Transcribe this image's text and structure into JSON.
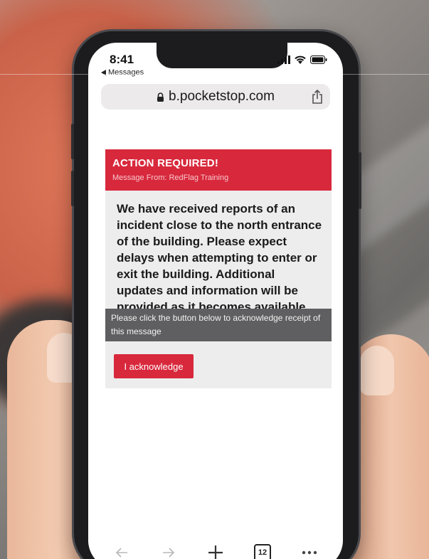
{
  "status_bar": {
    "time": "8:41",
    "back_label": "Messages"
  },
  "browser": {
    "url": "b.pocketstop.com",
    "tab_count": "12"
  },
  "alert": {
    "title": "ACTION REQUIRED!",
    "subtitle": "Message From: RedFlag Training",
    "body": "We have received reports of an incident close to the north entrance of the building. Please expect delays when attempting to enter or exit the building. Additional updates and information will be provided as it becomes available.",
    "prompt": "Please click the button below to acknowledge receipt of this message",
    "button_label": "I acknowledge"
  },
  "icons": {
    "back": "back-arrow-icon",
    "forward": "forward-arrow-icon",
    "center": "add-icon",
    "tabs": "tabs-icon",
    "more": "more-icon",
    "lock": "lock-icon",
    "share": "share-icon",
    "signal": "signal-icon",
    "wifi": "wifi-icon",
    "battery": "battery-icon"
  },
  "colors": {
    "banner": "#d8283c",
    "prompt_bar": "#5f5f61",
    "card": "#ededed"
  }
}
